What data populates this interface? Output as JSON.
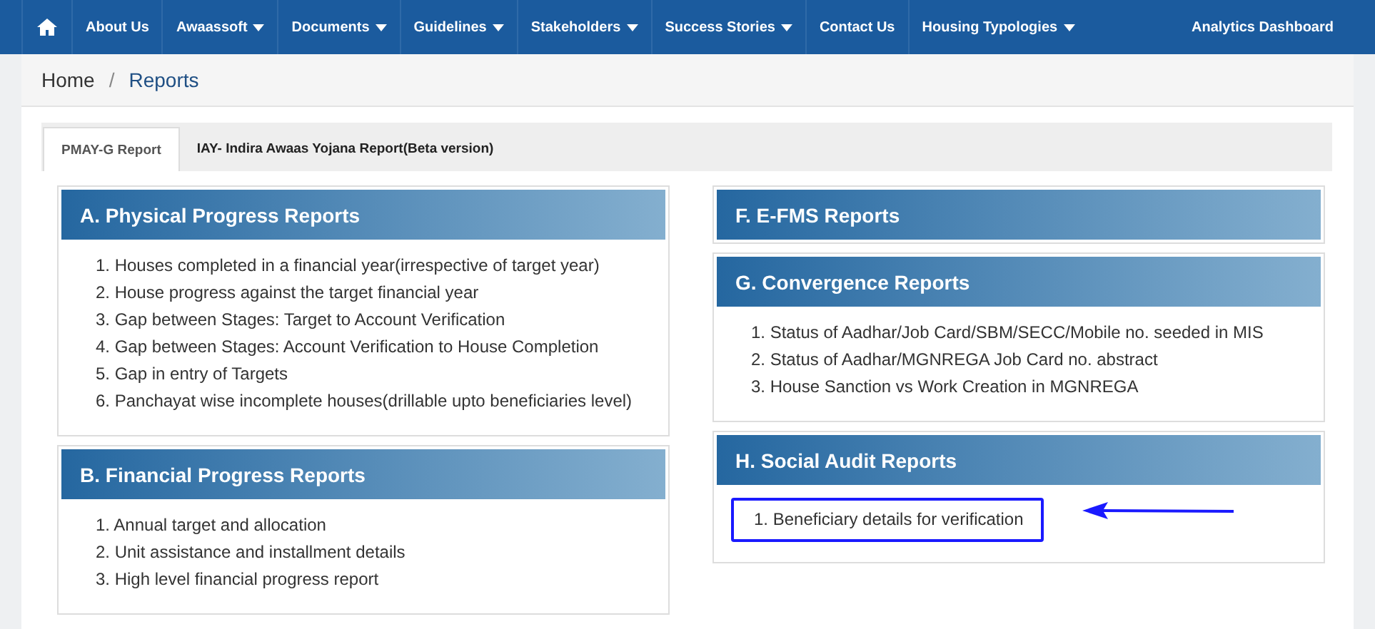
{
  "nav": {
    "items": [
      {
        "label": "About Us",
        "dropdown": false
      },
      {
        "label": "Awaassoft",
        "dropdown": true
      },
      {
        "label": "Documents",
        "dropdown": true
      },
      {
        "label": "Guidelines",
        "dropdown": true
      },
      {
        "label": "Stakeholders",
        "dropdown": true
      },
      {
        "label": "Success Stories",
        "dropdown": true
      },
      {
        "label": "Contact Us",
        "dropdown": false
      },
      {
        "label": "Housing Typologies",
        "dropdown": true
      }
    ],
    "right_link": "Analytics Dashboard"
  },
  "breadcrumb": {
    "items": [
      {
        "label": "Home",
        "selected": false
      },
      {
        "label": "Reports",
        "selected": true
      }
    ],
    "separator": "/"
  },
  "tabs": [
    {
      "label": "PMAY-G Report",
      "selected": true
    },
    {
      "label": "IAY- Indira Awaas Yojana Report(Beta version)",
      "selected": false
    }
  ],
  "columns": [
    {
      "panels": [
        {
          "title": "A. Physical Progress Reports",
          "items": [
            {
              "text": "1. Houses completed in a financial year(irrespective of target year)",
              "highlighted": false
            },
            {
              "text": "2. House progress against the target financial year",
              "highlighted": false
            },
            {
              "text": "3. Gap between Stages: Target to Account Verification",
              "highlighted": false
            },
            {
              "text": "4. Gap between Stages: Account Verification to House Completion",
              "highlighted": false
            },
            {
              "text": "5. Gap in entry of Targets",
              "highlighted": false
            },
            {
              "text": "6. Panchayat wise incomplete houses(drillable upto beneficiaries level)",
              "highlighted": false
            }
          ]
        },
        {
          "title": "B. Financial Progress Reports",
          "items": [
            {
              "text": "1. Annual target and allocation",
              "highlighted": false
            },
            {
              "text": "2. Unit assistance and installment details",
              "highlighted": false
            },
            {
              "text": "3. High level financial progress report",
              "highlighted": false
            }
          ]
        }
      ]
    },
    {
      "panels": [
        {
          "title": "F. E-FMS Reports"
        },
        {
          "title": "G. Convergence Reports",
          "items": [
            {
              "text": "1. Status of Aadhar/Job Card/SBM/SECC/Mobile no. seeded in MIS",
              "highlighted": false
            },
            {
              "text": "2. Status of Aadhar/MGNREGA Job Card no. abstract",
              "highlighted": false
            },
            {
              "text": "3. House Sanction vs Work Creation in MGNREGA",
              "highlighted": false
            }
          ]
        },
        {
          "title": "H. Social Audit Reports",
          "items": [
            {
              "text": "1. Beneficiary details for verification",
              "highlighted": true
            }
          ],
          "arrow": true
        }
      ]
    }
  ]
}
